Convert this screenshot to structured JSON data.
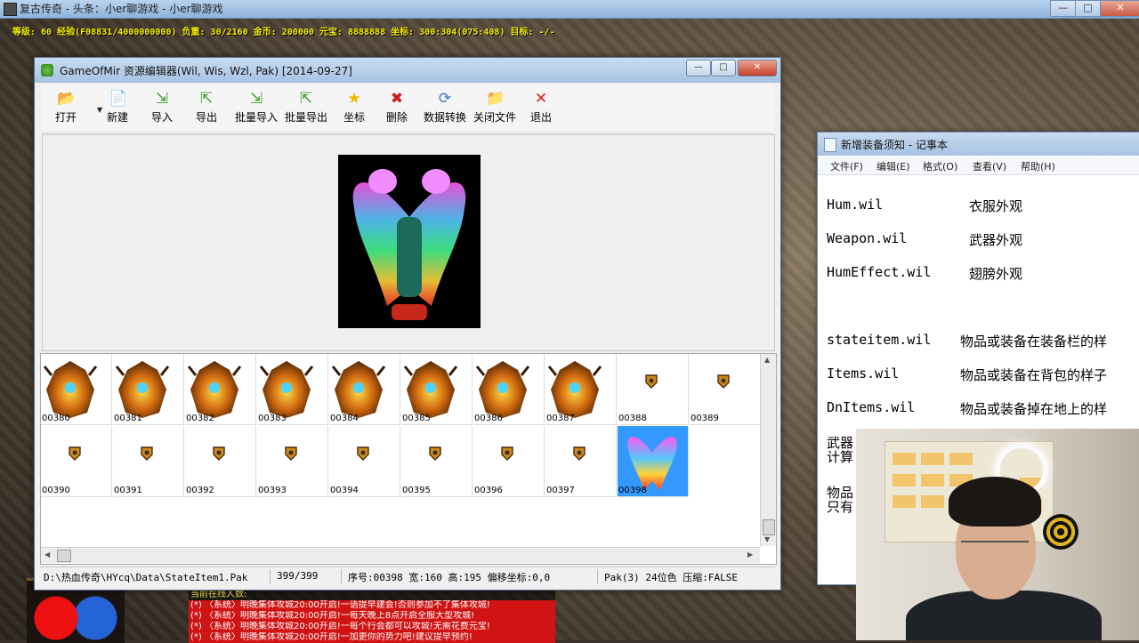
{
  "game": {
    "title": "复古传奇 - 头条：小er聊游戏 - 小er聊游戏",
    "status_line": "等级: 60 经验(F08831/4000000000) 负重: 30/2160 金币: 200000 元宝: 8888888 坐标: 300:304(075:408) 目标: -/-",
    "chat": [
      "当前在线人数:",
      "(*) 〈系统〉明晚集体攻城20:00开启!一语提早建会!否则参加不了集体攻城!",
      "(*) 〈系统〉明晚集体攻城20:00开启!一每天晚上8点开启全服大型攻城!",
      "(*) 〈系统〉明晚集体攻城20:00开启!一每个行会都可以攻城!无需花费元宝!",
      "(*) 〈系统〉明晚集体攻城20:00开启!一加更你的势力吧!建议提早预约!"
    ]
  },
  "editor": {
    "title": "GameOfMir 资源编辑器(Wil, Wis, Wzl, Pak) [2014-09-27]",
    "toolbar": [
      {
        "label": "打开",
        "icon": "open-folder-icon",
        "glyph": "📂"
      },
      {
        "label": "新建",
        "icon": "new-file-icon",
        "glyph": "📄"
      },
      {
        "label": "导入",
        "icon": "import-icon",
        "glyph": "⇲"
      },
      {
        "label": "导出",
        "icon": "export-icon",
        "glyph": "⇱"
      },
      {
        "label": "批量导入",
        "icon": "batch-import-icon",
        "glyph": "⇲"
      },
      {
        "label": "批量导出",
        "icon": "batch-export-icon",
        "glyph": "⇱"
      },
      {
        "label": "坐标",
        "icon": "star-icon",
        "glyph": "★"
      },
      {
        "label": "删除",
        "icon": "delete-icon",
        "glyph": "✖"
      },
      {
        "label": "数据转换",
        "icon": "convert-icon",
        "glyph": "⟳"
      },
      {
        "label": "关闭文件",
        "icon": "close-file-icon",
        "glyph": "📁"
      },
      {
        "label": "退出",
        "icon": "exit-icon",
        "glyph": "✕"
      }
    ],
    "grid_labels": [
      "00380",
      "00381",
      "00382",
      "00383",
      "00384",
      "00385",
      "00386",
      "00387",
      "00388",
      "00389",
      "00390",
      "00391",
      "00392",
      "00393",
      "00394",
      "00395",
      "00396",
      "00397",
      "00398"
    ],
    "selected_label": "00398",
    "status": {
      "path": "D:\\热血传奇\\HYcq\\Data\\StateItem1.Pak",
      "count": "399/399",
      "info": "序号:00398 宽:160 高:195 偏移坐标:0,0",
      "format": "Pak(3) 24位色 压缩:FALSE"
    }
  },
  "notepad": {
    "title": "新增装备须知 - 记事本",
    "menu": [
      "文件(F)",
      "编辑(E)",
      "格式(O)",
      "查看(V)",
      "帮助(H)"
    ],
    "lines": [
      {
        "file": "Hum.wil",
        "desc": "衣服外观"
      },
      {
        "file": "Weapon.wil",
        "desc": "武器外观"
      },
      {
        "file": "HumEffect.wil",
        "desc": "翅膀外观"
      },
      {
        "file": "stateitem.wil",
        "desc": "物品或装备在装备栏的样"
      },
      {
        "file": "Items.wil",
        "desc": "物品或装备在背包的样子"
      },
      {
        "file": "DnItems.wil",
        "desc": "物品或装备掉在地上的样"
      }
    ],
    "partial": [
      "武器",
      "计算",
      "物品",
      "只有"
    ]
  }
}
